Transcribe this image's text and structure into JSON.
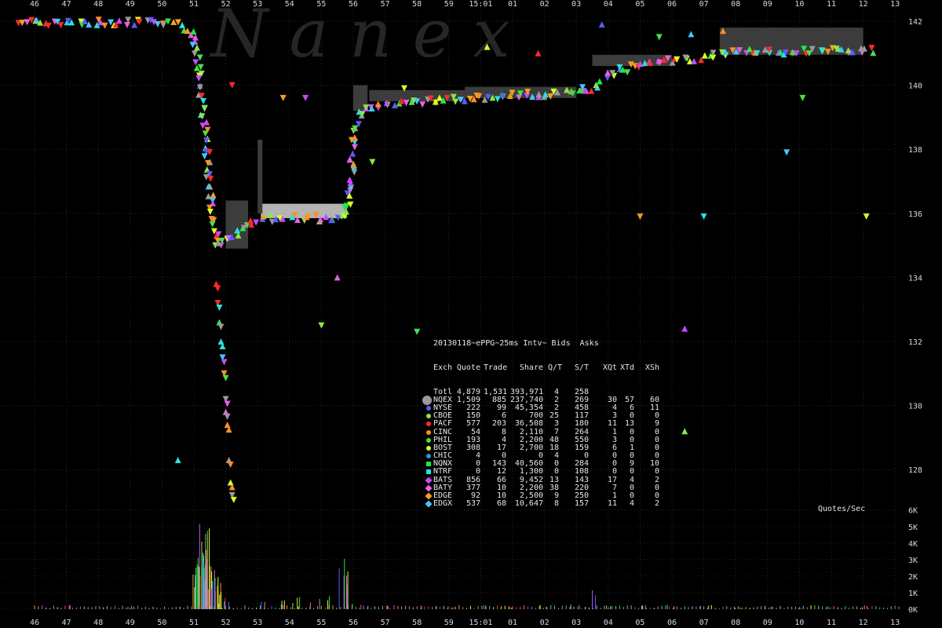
{
  "chart_data": {
    "type": "scatter",
    "title": "20130118~ePPG~25ms Intv~ Bids  Asks",
    "x_ticks_top": [
      "46",
      "47",
      "48",
      "49",
      "50",
      "51",
      "52",
      "53",
      "54",
      "55",
      "56",
      "57",
      "58",
      "59",
      "15:01",
      "01",
      "02",
      "03",
      "04",
      "05",
      "06",
      "07",
      "08",
      "09",
      "10",
      "11",
      "12",
      "13"
    ],
    "x_ticks_bottom": [
      "46",
      "47",
      "48",
      "49",
      "50",
      "51",
      "52",
      "53",
      "54",
      "55",
      "56",
      "57",
      "58",
      "59",
      "15:01",
      "01",
      "02",
      "03",
      "04",
      "05",
      "06",
      "07",
      "08",
      "09",
      "10",
      "11",
      "12",
      "13"
    ],
    "y_ticks": [
      "142",
      "140",
      "138",
      "136",
      "134",
      "132",
      "130",
      "128"
    ],
    "ylim": [
      126.5,
      142.3
    ],
    "qps_ticks": [
      "6K",
      "5K",
      "4K",
      "3K",
      "2K",
      "1K",
      "0K"
    ],
    "qps_label": "Quotes/Sec",
    "watermark": "N  a  n  e  x",
    "colors": {
      "NQEX": "#9a9a9a",
      "NYSE": "#5a5aff",
      "CBOE": "#8be64a",
      "PACF": "#ff2a2a",
      "CINC": "#ff8c2a",
      "PHIL": "#48e04a",
      "BOST": "#d7ff2a",
      "CHIC": "#2a9ad0",
      "NQNX": "#1ee84a",
      "NTRF": "#2ae0e0",
      "BATS": "#c84aff",
      "BATY": "#e860e0",
      "EDGE": "#f0a020",
      "EDGX": "#40c8ff",
      "band": "#3c3c3c",
      "band_light": "#b4b4b4"
    },
    "price_path": [
      [
        45.5,
        141.95
      ],
      [
        46.5,
        141.95
      ],
      [
        47.5,
        141.95
      ],
      [
        48.5,
        141.95
      ],
      [
        49.5,
        141.95
      ],
      [
        50.5,
        141.95
      ],
      [
        51.0,
        141.6
      ],
      [
        51.15,
        140.5
      ],
      [
        51.3,
        139.0
      ],
      [
        51.45,
        137.5
      ],
      [
        51.6,
        136.0
      ],
      [
        51.75,
        135.0
      ],
      [
        51.9,
        135.1
      ],
      [
        52.2,
        135.3
      ],
      [
        52.6,
        135.6
      ],
      [
        53.0,
        135.8
      ],
      [
        54.0,
        135.85
      ],
      [
        55.0,
        135.85
      ],
      [
        55.8,
        135.85
      ],
      [
        55.9,
        137.0
      ],
      [
        56.05,
        138.5
      ],
      [
        56.2,
        139.1
      ],
      [
        56.5,
        139.35
      ],
      [
        57.5,
        139.45
      ],
      [
        58.5,
        139.5
      ],
      [
        59.5,
        139.6
      ],
      [
        60.5,
        139.65
      ],
      [
        61.5,
        139.7
      ],
      [
        62.5,
        139.75
      ],
      [
        63.5,
        139.9
      ],
      [
        64.0,
        140.3
      ],
      [
        64.5,
        140.55
      ],
      [
        65.5,
        140.7
      ],
      [
        66.5,
        140.8
      ],
      [
        67.5,
        140.95
      ],
      [
        68.5,
        141.05
      ],
      [
        69.5,
        141.05
      ],
      [
        72.5,
        141.1
      ]
    ],
    "selloff_spikes": [
      [
        51.7,
        133.8
      ],
      [
        51.75,
        133.2
      ],
      [
        51.8,
        132.6
      ],
      [
        51.85,
        132.0
      ],
      [
        51.9,
        131.5
      ],
      [
        51.95,
        131.0
      ],
      [
        52.0,
        130.2
      ],
      [
        52.0,
        129.8
      ],
      [
        52.05,
        129.4
      ],
      [
        52.1,
        128.3
      ],
      [
        52.15,
        127.6
      ],
      [
        52.2,
        127.2
      ]
    ],
    "outlier_points": [
      [
        52.2,
        140.0
      ],
      [
        53.8,
        139.6
      ],
      [
        54.5,
        139.6
      ],
      [
        56.4,
        139.3
      ],
      [
        56.6,
        137.6
      ],
      [
        57.6,
        139.9
      ],
      [
        60.2,
        141.2
      ],
      [
        61.8,
        141.0
      ],
      [
        63.8,
        141.9
      ],
      [
        64.6,
        140.4
      ],
      [
        65.6,
        141.5
      ],
      [
        66.6,
        141.6
      ],
      [
        67.6,
        141.7
      ],
      [
        69.6,
        137.9
      ],
      [
        70.1,
        139.6
      ],
      [
        65.0,
        135.9
      ],
      [
        65.0,
        135.9
      ],
      [
        67.0,
        135.9
      ],
      [
        72.1,
        135.9
      ],
      [
        55.5,
        134.0
      ],
      [
        55.0,
        132.5
      ],
      [
        58.0,
        132.3
      ],
      [
        66.4,
        132.4
      ],
      [
        66.4,
        129.2
      ],
      [
        50.5,
        128.3
      ]
    ],
    "bands": [
      {
        "x0": 52.0,
        "x1": 52.7,
        "y0": 134.9,
        "y1": 136.4,
        "c": "band"
      },
      {
        "x0": 53.1,
        "x1": 55.8,
        "y0": 135.85,
        "y1": 136.3,
        "c": "band_light"
      },
      {
        "x0": 53.0,
        "x1": 53.15,
        "y0": 136.0,
        "y1": 138.3,
        "c": "band"
      },
      {
        "x0": 56.0,
        "x1": 56.45,
        "y0": 139.2,
        "y1": 140.0,
        "c": "band"
      },
      {
        "x0": 56.5,
        "x1": 59.5,
        "y0": 139.5,
        "y1": 139.85,
        "c": "band"
      },
      {
        "x0": 59.5,
        "x1": 63.0,
        "y0": 139.6,
        "y1": 139.95,
        "c": "band"
      },
      {
        "x0": 63.5,
        "x1": 66.0,
        "y0": 140.6,
        "y1": 140.95,
        "c": "band"
      },
      {
        "x0": 67.5,
        "x1": 72.0,
        "y0": 140.95,
        "y1": 141.8,
        "c": "band"
      }
    ],
    "volume_bursts": [
      [
        51.1,
        2800
      ],
      [
        51.2,
        3600
      ],
      [
        51.3,
        5200
      ],
      [
        51.35,
        4600
      ],
      [
        51.45,
        5400
      ],
      [
        51.5,
        3900
      ],
      [
        51.6,
        2600
      ],
      [
        51.7,
        1900
      ],
      [
        51.8,
        1200
      ],
      [
        51.9,
        800
      ],
      [
        52.0,
        500
      ],
      [
        47.0,
        400
      ],
      [
        49.0,
        350
      ],
      [
        53.2,
        500
      ],
      [
        53.6,
        600
      ],
      [
        54.0,
        700
      ],
      [
        54.4,
        900
      ],
      [
        54.8,
        800
      ],
      [
        55.3,
        900
      ],
      [
        55.7,
        3300
      ],
      [
        56.0,
        600
      ],
      [
        56.4,
        300
      ],
      [
        57.0,
        250
      ],
      [
        58.0,
        250
      ],
      [
        59.0,
        200
      ],
      [
        60.0,
        300
      ],
      [
        61.0,
        200
      ],
      [
        62.0,
        250
      ],
      [
        63.0,
        300
      ],
      [
        63.5,
        1200
      ],
      [
        64.0,
        400
      ],
      [
        65.0,
        300
      ],
      [
        66.0,
        300
      ],
      [
        67.0,
        400
      ],
      [
        68.0,
        200
      ],
      [
        69.0,
        200
      ],
      [
        70.0,
        200
      ],
      [
        71.0,
        200
      ],
      [
        72.0,
        200
      ]
    ],
    "legend_title": "20130118~ePPG~25ms Intv~ Bids  Asks",
    "table_columns": [
      "Exch",
      "Quote",
      "Trade",
      "Share",
      "Q/T",
      "S/T",
      "XQt",
      "XTd",
      "XSh"
    ],
    "table": [
      {
        "exch": "Totl",
        "quote": "4,879",
        "trade": "1,531",
        "share": "393,971",
        "qt": "4",
        "st": "258",
        "xqt": "",
        "xtd": "",
        "xsh": "",
        "color": ""
      },
      {
        "exch": "NQEX",
        "quote": "1,509",
        "trade": "885",
        "share": "237,740",
        "qt": "2",
        "st": "269",
        "xqt": "30",
        "xtd": "57",
        "xsh": "60",
        "color": "#9a9a9a",
        "big": true
      },
      {
        "exch": "NYSE",
        "quote": "222",
        "trade": "99",
        "share": "45,354",
        "qt": "2",
        "st": "458",
        "xqt": "4",
        "xtd": "6",
        "xsh": "11",
        "color": "#5a5aff"
      },
      {
        "exch": "CBOE",
        "quote": "150",
        "trade": "6",
        "share": "700",
        "qt": "25",
        "st": "117",
        "xqt": "3",
        "xtd": "0",
        "xsh": "0",
        "color": "#8be64a"
      },
      {
        "exch": "PACF",
        "quote": "577",
        "trade": "203",
        "share": "36,508",
        "qt": "3",
        "st": "180",
        "xqt": "11",
        "xtd": "13",
        "xsh": "9",
        "color": "#ff2a2a"
      },
      {
        "exch": "CINC",
        "quote": "54",
        "trade": "8",
        "share": "2,110",
        "qt": "7",
        "st": "264",
        "xqt": "1",
        "xtd": "0",
        "xsh": "0",
        "color": "#ff8c2a"
      },
      {
        "exch": "PHIL",
        "quote": "193",
        "trade": "4",
        "share": "2,200",
        "qt": "48",
        "st": "550",
        "xqt": "3",
        "xtd": "0",
        "xsh": "0",
        "color": "#48e04a"
      },
      {
        "exch": "BOST",
        "quote": "308",
        "trade": "17",
        "share": "2,700",
        "qt": "18",
        "st": "159",
        "xqt": "6",
        "xtd": "1",
        "xsh": "0",
        "color": "#d7ff2a"
      },
      {
        "exch": "CHIC",
        "quote": "4",
        "trade": "0",
        "share": "0",
        "qt": "4",
        "st": "0",
        "xqt": "0",
        "xtd": "0",
        "xsh": "0",
        "color": "#2a9ad0"
      },
      {
        "exch": "NQNX",
        "quote": "0",
        "trade": "143",
        "share": "40,560",
        "qt": "0",
        "st": "284",
        "xqt": "0",
        "xtd": "9",
        "xsh": "10",
        "color": "#1ee84a"
      },
      {
        "exch": "NTRF",
        "quote": "0",
        "trade": "12",
        "share": "1,300",
        "qt": "0",
        "st": "108",
        "xqt": "0",
        "xtd": "0",
        "xsh": "0",
        "color": "#2ae0e0"
      },
      {
        "exch": "BATS",
        "quote": "856",
        "trade": "66",
        "share": "9,452",
        "qt": "13",
        "st": "143",
        "xqt": "17",
        "xtd": "4",
        "xsh": "2",
        "color": "#c84aff"
      },
      {
        "exch": "BATY",
        "quote": "377",
        "trade": "10",
        "share": "2,200",
        "qt": "38",
        "st": "220",
        "xqt": "7",
        "xtd": "0",
        "xsh": "0",
        "color": "#e860e0"
      },
      {
        "exch": "EDGE",
        "quote": "92",
        "trade": "10",
        "share": "2,500",
        "qt": "9",
        "st": "250",
        "xqt": "1",
        "xtd": "0",
        "xsh": "0",
        "color": "#f0a020"
      },
      {
        "exch": "EDGX",
        "quote": "537",
        "trade": "68",
        "share": "10,647",
        "qt": "8",
        "st": "157",
        "xqt": "11",
        "xtd": "4",
        "xsh": "2",
        "color": "#40c8ff"
      }
    ]
  }
}
